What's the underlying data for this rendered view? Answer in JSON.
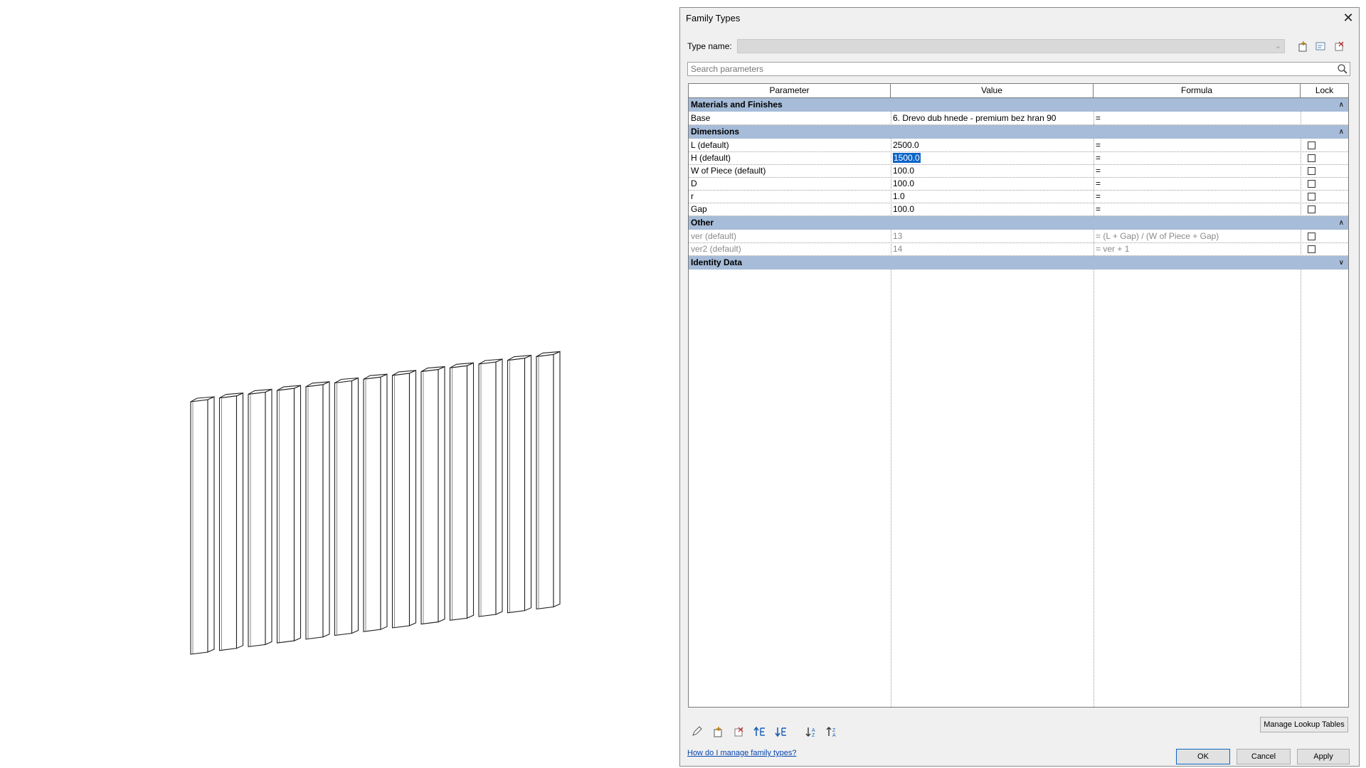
{
  "dialog": {
    "title": "Family Types",
    "close_symbol": "✕",
    "type_name_label": "Type name:",
    "type_name_value": "",
    "search_placeholder": "Search parameters"
  },
  "grid": {
    "headers": [
      "Parameter",
      "Value",
      "Formula",
      "Lock"
    ],
    "groups": [
      {
        "name": "Materials and Finishes",
        "collapsed": false,
        "rows": [
          {
            "param": "Base",
            "value": "6. Drevo dub hnede - premium bez hran 90",
            "formula": "=",
            "lock": null,
            "dim": false
          }
        ]
      },
      {
        "name": "Dimensions",
        "collapsed": false,
        "rows": [
          {
            "param": "L (default)",
            "value": "2500.0",
            "formula": "=",
            "lock": false,
            "dim": false
          },
          {
            "param": "H (default)",
            "value": "1500.0",
            "formula": "=",
            "lock": false,
            "dim": false,
            "selected": true
          },
          {
            "param": "W of Piece (default)",
            "value": "100.0",
            "formula": "=",
            "lock": false,
            "dim": false
          },
          {
            "param": "D",
            "value": "100.0",
            "formula": "=",
            "lock": false,
            "dim": false
          },
          {
            "param": "r",
            "value": "1.0",
            "formula": "=",
            "lock": false,
            "dim": false
          },
          {
            "param": "Gap",
            "value": "100.0",
            "formula": "=",
            "lock": false,
            "dim": false
          }
        ]
      },
      {
        "name": "Other",
        "collapsed": false,
        "rows": [
          {
            "param": "ver (default)",
            "value": "13",
            "formula": "= (L + Gap) / (W of Piece + Gap)",
            "lock": false,
            "dim": true
          },
          {
            "param": "ver2 (default)",
            "value": "14",
            "formula": "= ver + 1",
            "lock": false,
            "dim": true
          }
        ]
      },
      {
        "name": "Identity Data",
        "collapsed": true,
        "rows": []
      }
    ]
  },
  "toolbar_icons": [
    "new-type-icon",
    "rename-type-icon",
    "delete-type-icon"
  ],
  "bottom_icons": [
    "edit-parameter-icon",
    "new-parameter-icon",
    "delete-parameter-icon",
    "move-up-icon",
    "move-down-icon",
    "sort-ascending-icon",
    "sort-descending-icon"
  ],
  "footer": {
    "lookup_label": "Manage Lookup Tables",
    "help_link": "How do I manage family types?",
    "ok_label": "OK",
    "cancel_label": "Cancel",
    "apply_label": "Apply"
  },
  "viewport": {
    "piece_count": 13
  }
}
